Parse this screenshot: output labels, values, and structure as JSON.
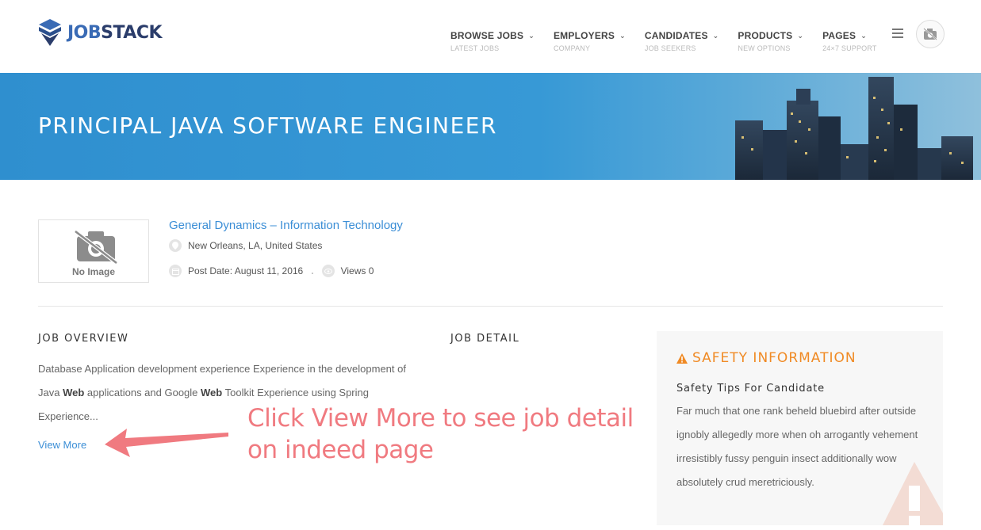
{
  "header": {
    "logo": {
      "text_part1": "JOB",
      "text_part2": "STACK"
    },
    "nav": [
      {
        "label": "BROWSE JOBS",
        "sub": "LATEST JOBS"
      },
      {
        "label": "EMPLOYERS",
        "sub": "COMPANY"
      },
      {
        "label": "CANDIDATES",
        "sub": "JOB SEEKERS"
      },
      {
        "label": "PRODUCTS",
        "sub": "NEW OPTIONS"
      },
      {
        "label": "PAGES",
        "sub": "24×7 SUPPORT"
      }
    ],
    "menu_icon": "hamburger-icon",
    "avatar_icon": "user-avatar-icon"
  },
  "banner": {
    "title": "PRINCIPAL JAVA SOFTWARE ENGINEER"
  },
  "company": {
    "image_label": "No Image",
    "name": "General Dynamics – Information Technology",
    "location": "New Orleans, LA, United States",
    "post_date": "Post Date: August 11, 2016",
    "views": "Views 0"
  },
  "overview": {
    "title": "JOB OVERVIEW",
    "text_1": "Database Application development experience Experience in the development of Java ",
    "bold_1": "Web",
    "text_2": " applications and Google ",
    "bold_2": "Web",
    "text_3": " Toolkit Experience using Spring Experience...",
    "view_more": "View More"
  },
  "detail": {
    "title": "JOB DETAIL"
  },
  "annotation": {
    "line1": "Click View More to see job detail",
    "line2": "on indeed page",
    "color": "#f07a80"
  },
  "safety": {
    "title": "SAFETY INFORMATION",
    "subtitle": "Safety Tips For Candidate",
    "text": "Far much that one rank beheld bluebird after outside ignobly allegedly more when oh arrogantly vehement irresistibly fussy penguin insect additionally wow absolutely crud meretriciously.",
    "accent": "#f08a24"
  },
  "colors": {
    "banner": "#3799d6",
    "link": "#3b8ed6"
  }
}
